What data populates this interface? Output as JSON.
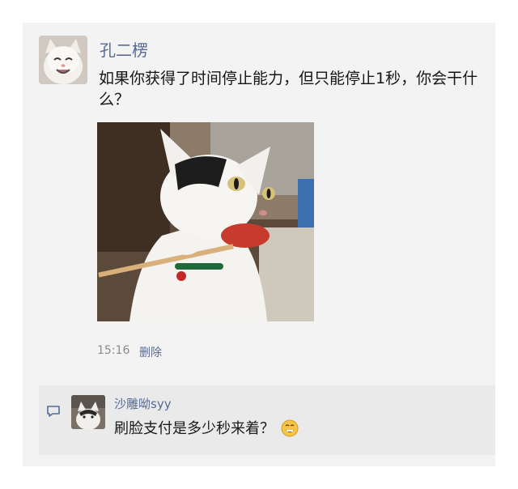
{
  "post": {
    "username": "孔二楞",
    "message": "如果你获得了时间停止能力，但只能停止1秒，你会干什么？",
    "timestamp": "15:16",
    "delete_label": "删除"
  },
  "comment": {
    "author": "沙雕呦syy",
    "text": "刷脸支付是多少秒来着？",
    "emoji_icon": "grinning-money-face-emoji"
  },
  "colors": {
    "link_blue": "#576b95",
    "comment_bg": "#eaeaea",
    "card_bg": "#f3f3f3"
  }
}
